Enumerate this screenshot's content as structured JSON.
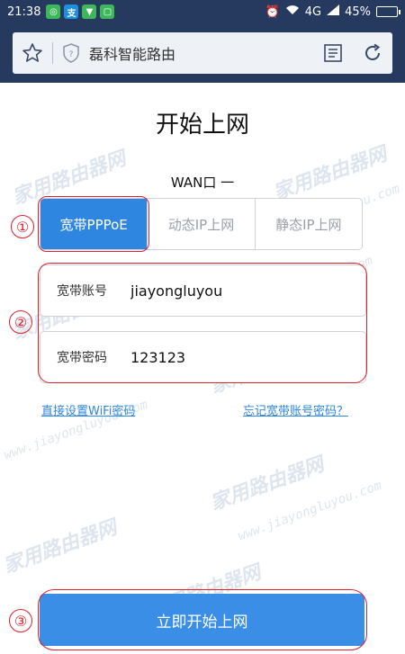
{
  "status_bar": {
    "time": "21:38",
    "network": "4G",
    "battery": "45%",
    "battery_level": 0.45
  },
  "browser": {
    "title": "磊科智能路由"
  },
  "page": {
    "title": "开始上网",
    "wan_label": "WAN口 一",
    "tabs": [
      {
        "label": "宽带PPPoE",
        "active": true
      },
      {
        "label": "动态IP上网",
        "active": false
      },
      {
        "label": "静态IP上网",
        "active": false
      }
    ],
    "fields": {
      "account_label": "宽带账号",
      "account_value": "jiayongluyou",
      "password_label": "宽带密码",
      "password_value": "123123"
    },
    "links": {
      "wifi": "直接设置WiFi密码",
      "forgot": "忘记宽带账号密码？"
    },
    "start_button": "立即开始上网"
  },
  "annotations": {
    "marker_1": "①",
    "marker_2": "②",
    "marker_3": "③"
  },
  "watermark": {
    "text": "家用路由器网",
    "sub": "www.jiayongluyou.com"
  },
  "colors": {
    "accent": "#2e86e0",
    "header": "#26395f",
    "annotation": "#e0202a"
  }
}
